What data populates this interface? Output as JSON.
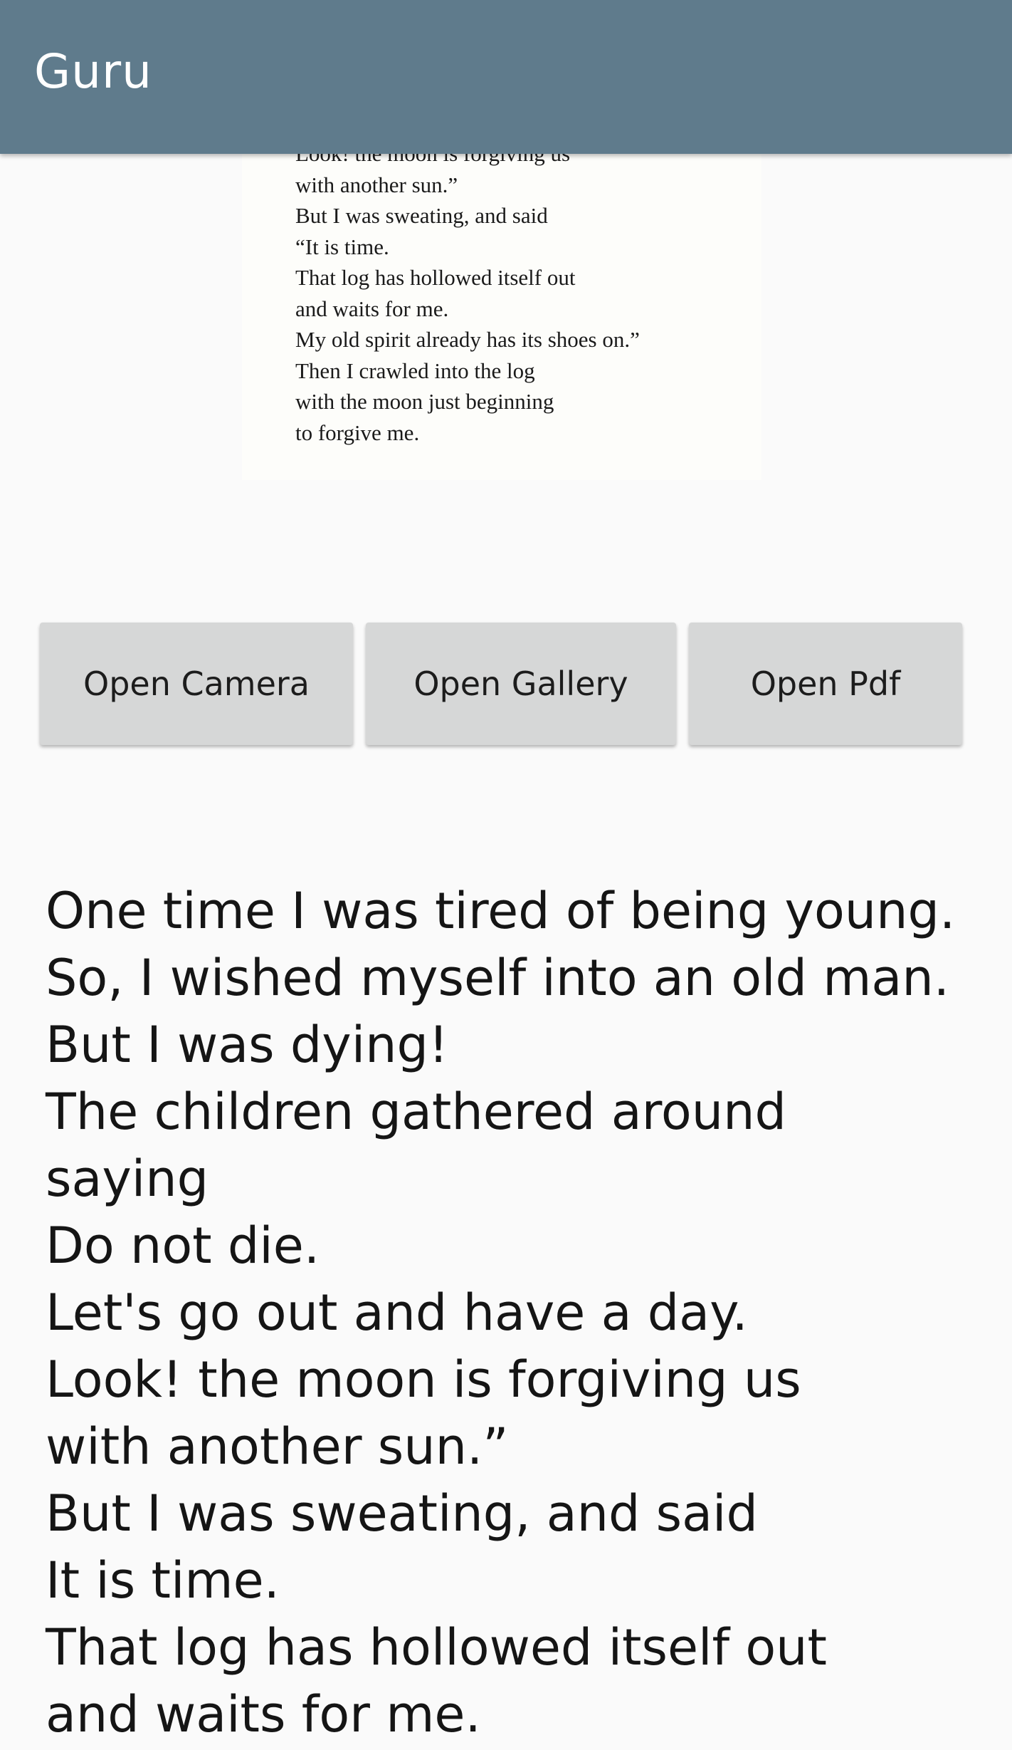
{
  "appbar": {
    "title": "Guru"
  },
  "preview": {
    "lines": [
      "Look! the moon is forgiving us",
      "with another sun.”",
      "But I was sweating, and said",
      "“It is time.",
      "That log has hollowed itself out",
      "and waits for me.",
      "My old spirit already has its shoes on.”",
      "Then I crawled into the log",
      "with the moon just beginning",
      "to forgive me."
    ]
  },
  "buttons": {
    "camera_label": "Open Camera",
    "gallery_label": "Open Gallery",
    "pdf_label": "Open Pdf"
  },
  "result": {
    "lines": [
      "One time I was tired of being young.",
      "So, I wished myself into an old man.",
      "But I was dying!",
      "The children gathered around",
      "saying",
      "Do not die.",
      "Let's go out and have a day.",
      "Look! the moon is forgiving us",
      "with another sun.”",
      "But I was sweating, and said",
      "It is time.",
      "That log has hollowed itself out",
      "and waits for me."
    ]
  }
}
